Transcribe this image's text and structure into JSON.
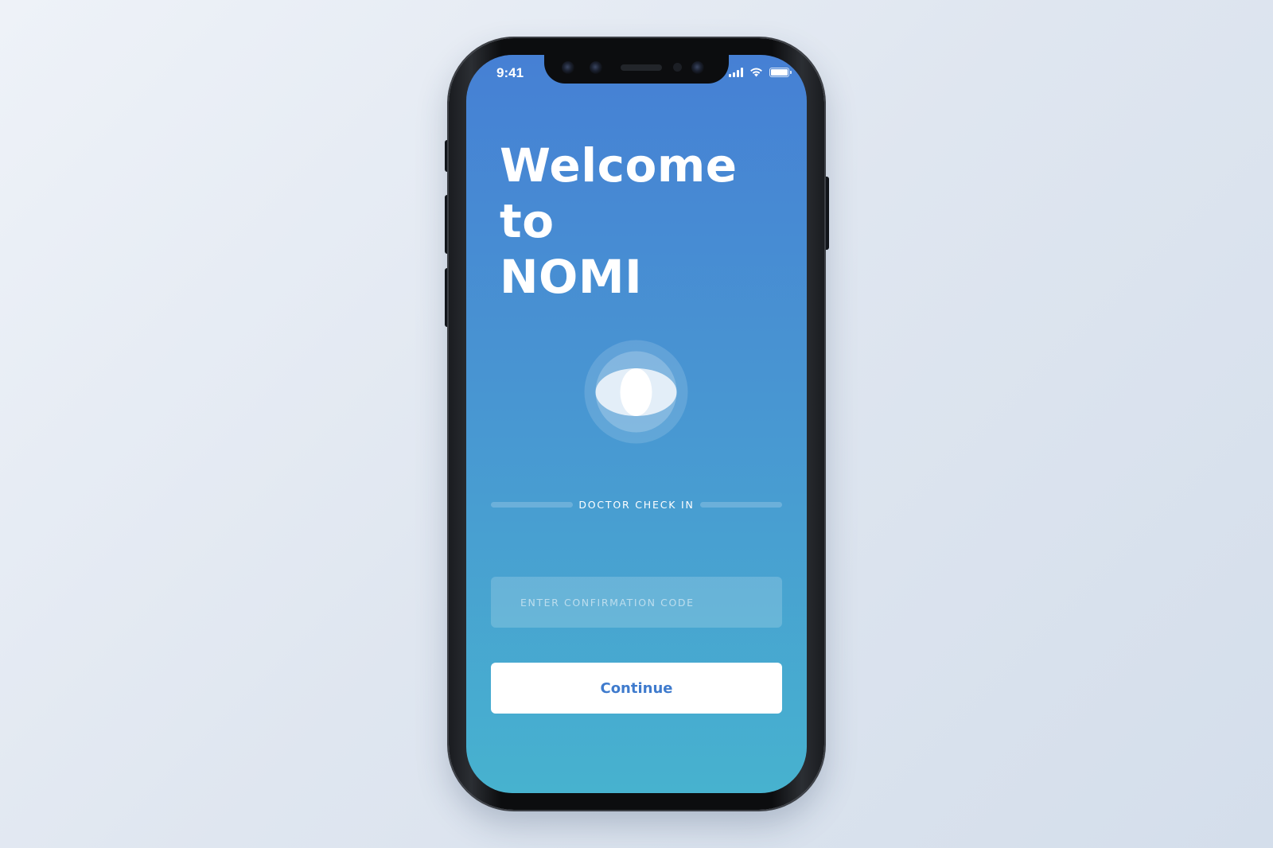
{
  "status_bar": {
    "time": "9:41",
    "icons": [
      "cellular-signal-icon",
      "wifi-icon",
      "battery-icon"
    ]
  },
  "welcome": {
    "line1": "Welcome",
    "line2": "to",
    "line3": "NOMI"
  },
  "logo": {
    "icon": "nomi-eye-logo-icon"
  },
  "section": {
    "label": "DOCTOR CHECK IN"
  },
  "form": {
    "code_placeholder": "ENTER CONFIRMATION CODE",
    "code_value": "",
    "continue_label": "Continue"
  },
  "colors": {
    "gradient_top": "#4680d4",
    "gradient_bottom": "#47b2cf",
    "button_text": "#3f7bcd",
    "background": "#e3e9f2"
  }
}
